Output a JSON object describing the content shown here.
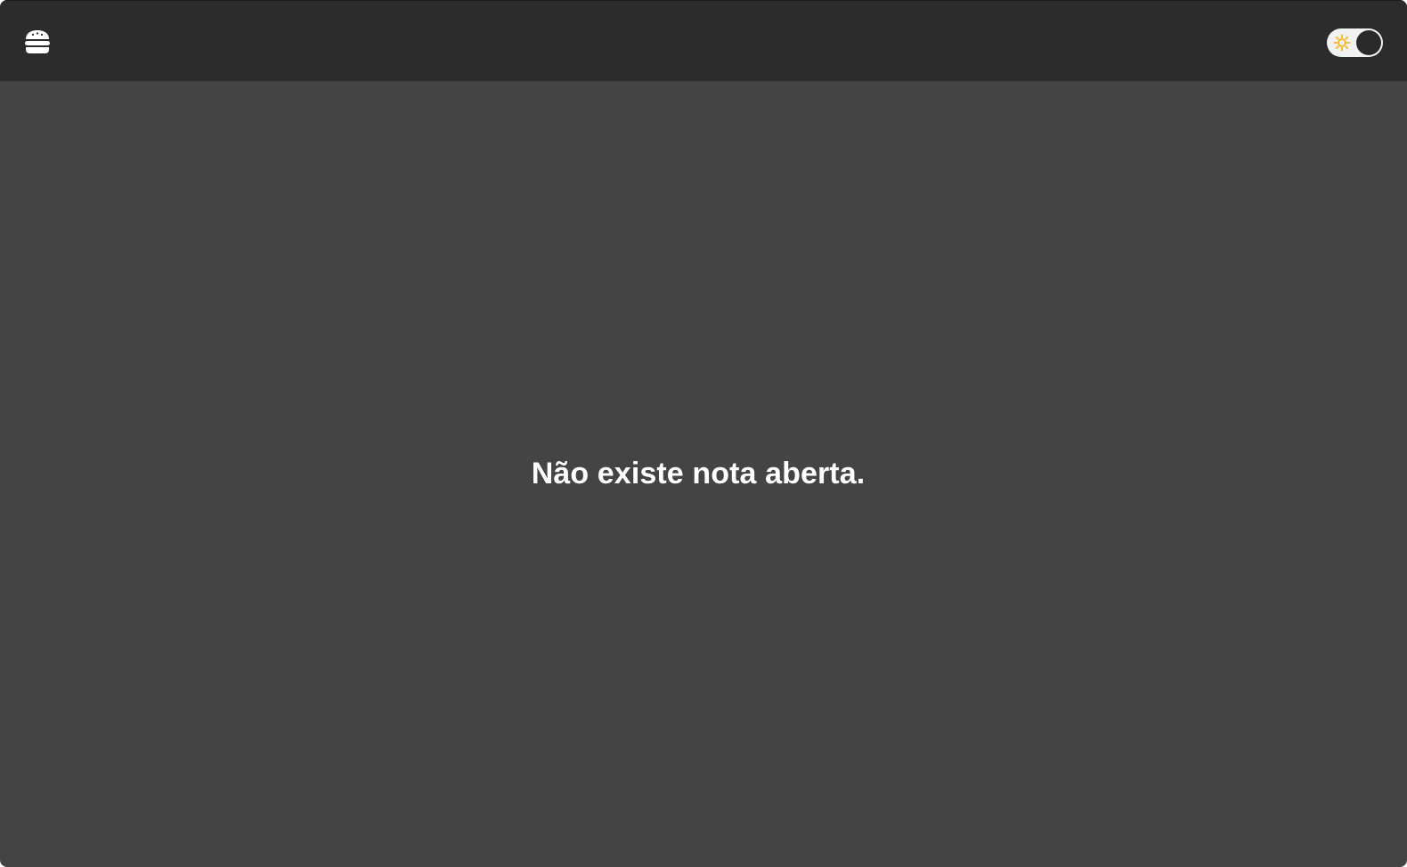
{
  "header": {
    "menu_icon": "hamburger-icon",
    "theme_toggle": {
      "icon": "sun-icon",
      "state": "dark",
      "sun_color": "#f5b82e"
    }
  },
  "main": {
    "empty_message": "Não existe nota aberta."
  },
  "colors": {
    "topbar_background": "#2c2c2c",
    "content_background": "#444444",
    "text": "#ffffff"
  }
}
